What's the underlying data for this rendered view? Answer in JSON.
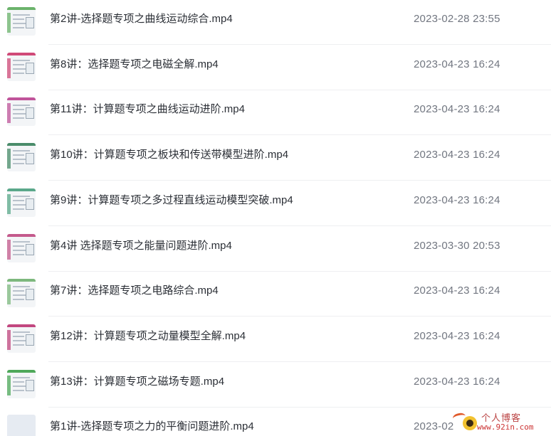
{
  "files": [
    {
      "name": "第2讲-选择题专项之曲线运动综合.mp4",
      "date": "2023-02-28 23:55",
      "thumb_accent": "#6bb36b",
      "thumb_icon": "video-thumbnail-icon"
    },
    {
      "name": "第8讲：选择题专项之电磁全解.mp4",
      "date": "2023-04-23 16:24",
      "thumb_accent": "#d04a78",
      "thumb_icon": "video-thumbnail-icon"
    },
    {
      "name": "第11讲：计算题专项之曲线运动进阶.mp4",
      "date": "2023-04-23 16:24",
      "thumb_accent": "#c0549a",
      "thumb_icon": "video-thumbnail-icon"
    },
    {
      "name": "第10讲：计算题专项之板块和传送带模型进阶.mp4",
      "date": "2023-04-23 16:24",
      "thumb_accent": "#4a8c6a",
      "thumb_icon": "video-thumbnail-icon"
    },
    {
      "name": "第9讲：计算题专项之多过程直线运动模型突破.mp4",
      "date": "2023-04-23 16:24",
      "thumb_accent": "#5aa88a",
      "thumb_icon": "video-thumbnail-icon"
    },
    {
      "name": "第4讲 选择题专项之能量问题进阶.mp4",
      "date": "2023-03-30 20:53",
      "thumb_accent": "#c45a8c",
      "thumb_icon": "video-thumbnail-icon"
    },
    {
      "name": "第7讲：选择题专项之电路综合.mp4",
      "date": "2023-04-23 16:24",
      "thumb_accent": "#7db87d",
      "thumb_icon": "video-thumbnail-icon"
    },
    {
      "name": "第12讲：计算题专项之动量模型全解.mp4",
      "date": "2023-04-23 16:24",
      "thumb_accent": "#c2477f",
      "thumb_icon": "video-thumbnail-icon"
    },
    {
      "name": "第13讲：计算题专项之磁场专题.mp4",
      "date": "2023-04-23 16:24",
      "thumb_accent": "#4ea85a",
      "thumb_icon": "video-thumbnail-icon"
    },
    {
      "name": "第1讲-选择题专项之力的平衡问题进阶.mp4",
      "date": "2023-02",
      "thumb_accent": "#e6ebf2",
      "thumb_icon": "video-thumbnail-icon"
    }
  ],
  "watermark": {
    "title": "个人博客",
    "url": "www.92in.com"
  }
}
